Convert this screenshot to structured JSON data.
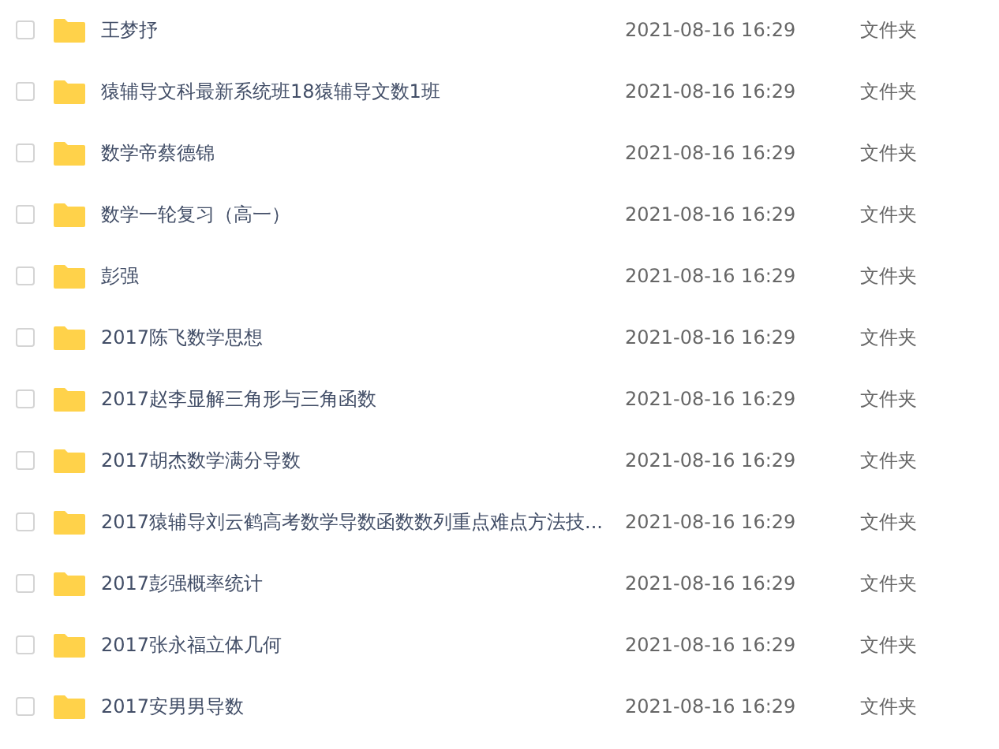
{
  "files": [
    {
      "name": "王梦抒",
      "modified": "2021-08-16 16:29",
      "type": "文件夹",
      "checked": false
    },
    {
      "name": "猿辅导文科最新系统班18猿辅导文数1班",
      "modified": "2021-08-16 16:29",
      "type": "文件夹",
      "checked": false
    },
    {
      "name": "数学帝蔡德锦",
      "modified": "2021-08-16 16:29",
      "type": "文件夹",
      "checked": false
    },
    {
      "name": "数学一轮复习（高一）",
      "modified": "2021-08-16 16:29",
      "type": "文件夹",
      "checked": false
    },
    {
      "name": "彭强",
      "modified": "2021-08-16 16:29",
      "type": "文件夹",
      "checked": false
    },
    {
      "name": "2017陈飞数学思想",
      "modified": "2021-08-16 16:29",
      "type": "文件夹",
      "checked": false
    },
    {
      "name": "2017赵李显解三角形与三角函数",
      "modified": "2021-08-16 16:29",
      "type": "文件夹",
      "checked": false
    },
    {
      "name": "2017胡杰数学满分导数",
      "modified": "2021-08-16 16:29",
      "type": "文件夹",
      "checked": false
    },
    {
      "name": "2017猿辅导刘云鹤高考数学导数函数数列重点难点方法技...",
      "modified": "2021-08-16 16:29",
      "type": "文件夹",
      "checked": false
    },
    {
      "name": "2017彭强概率统计",
      "modified": "2021-08-16 16:29",
      "type": "文件夹",
      "checked": false
    },
    {
      "name": "2017张永福立体几何",
      "modified": "2021-08-16 16:29",
      "type": "文件夹",
      "checked": false
    },
    {
      "name": "2017安男男导数",
      "modified": "2021-08-16 16:29",
      "type": "文件夹",
      "checked": false
    }
  ]
}
